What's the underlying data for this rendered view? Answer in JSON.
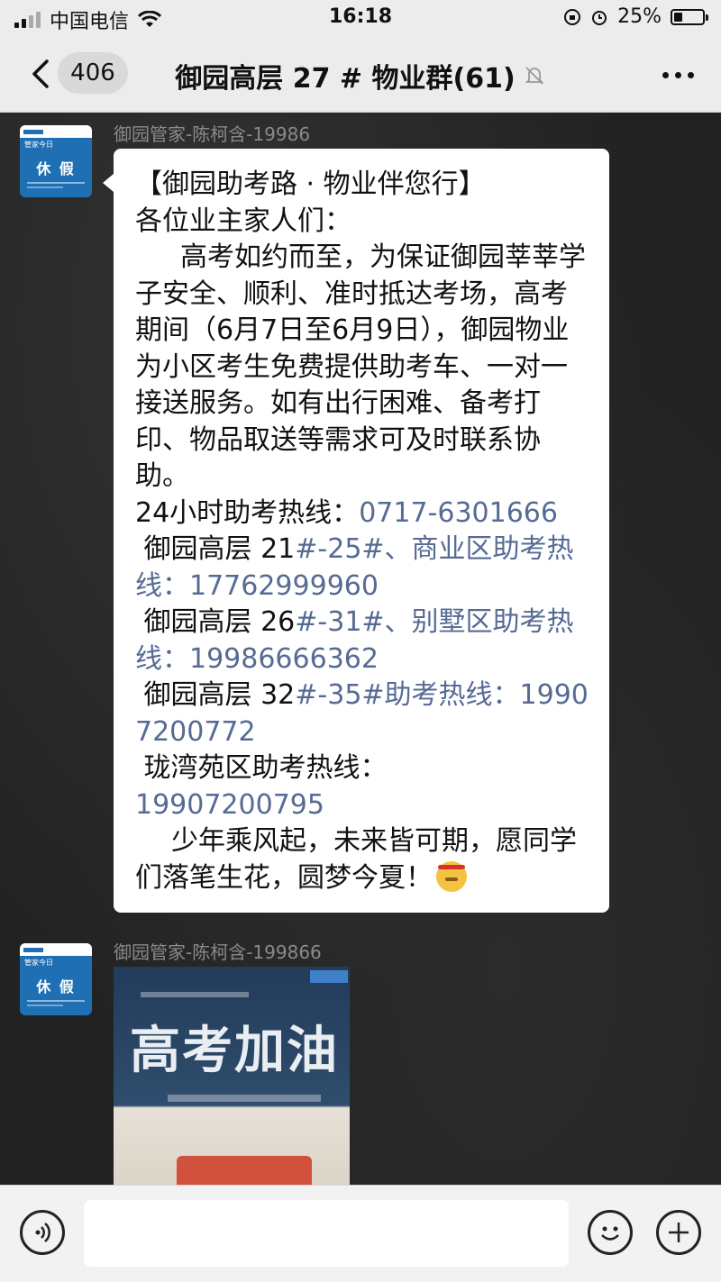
{
  "status_bar": {
    "carrier": "中国电信",
    "time": "16:18",
    "battery": "25%"
  },
  "nav": {
    "unread_count": "406",
    "title": "御园高层 27 # 物业群(61)"
  },
  "messages": [
    {
      "sender": "御园管家-陈柯含-19986",
      "avatar": {
        "subtitle": "管家今日",
        "main": "休 假"
      },
      "text": {
        "title": "【御园助考路 · 物业伴您行】",
        "greeting": "各位业主家人们：",
        "body": "高考如约而至，为保证御园莘莘学子安全、顺利、准时抵达考场，高考期间（6月7日至6月9日），御园物业为小区考生免费提供助考车、一对一接送服务。如有出行困难、备考打印、物品取送等需求可及时联系协助。",
        "hotline_label": "24小时助考热线：",
        "hotline_number": "0717-6301666",
        "line1_prefix": " 御园高层 21",
        "line1_link": "#-25#、商业区助考热线：17762999960",
        "line2_prefix": " 御园高层 26",
        "line2_link": "#-31#、别墅区助考热线：19986666362",
        "line3_prefix": " 御园高层 32",
        "line3_link": "#-35#助考热线：19907200772",
        "line4_label": " 珑湾苑区助考热线：",
        "line4_number": "19907200795",
        "closing": "少年乘风起，未来皆可期，愿同学们落笔生花，圆梦今夏！"
      }
    },
    {
      "sender": "御园管家-陈柯含-199866",
      "avatar": {
        "subtitle": "管家今日",
        "main": "休 假"
      },
      "image_text": "高考加油"
    }
  ]
}
